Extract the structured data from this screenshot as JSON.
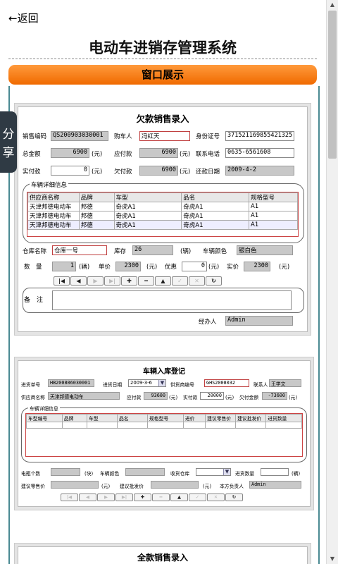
{
  "header": {
    "back_label": "返回",
    "title": "电动车进销存管理系统",
    "section_button": "窗口展示",
    "share_label": "分享"
  },
  "shot1": {
    "title": "欠款销售录入",
    "sales_code_label": "销售编码",
    "sales_code": "QS200903030001",
    "buyer_label": "购车人",
    "buyer": "冯红天",
    "id_label": "身份证号",
    "id_no": "371521169855421325",
    "total_label": "总金额",
    "total": "6900",
    "yuan1": "(元)",
    "due_label": "应付款",
    "due": "6900",
    "yuan2": "(元)",
    "phone_label": "联系电话",
    "phone": "0635-6561608",
    "paid_label": "实付款",
    "paid": "0",
    "yuan3": "(元)",
    "owed_label": "欠付款",
    "owed": "6900",
    "yuan4": "(元)",
    "repay_label": "还款日期",
    "repay_date": "2009-4-2",
    "detail_caption": "车辆详细信息",
    "columns": [
      "供应商名称",
      "品牌",
      "车型",
      "品名",
      "规格型号"
    ],
    "rows": [
      [
        "天津邦德电动车",
        "邦德",
        "奇虎A1",
        "奇虎A1",
        "A1"
      ],
      [
        "天津邦德电动车",
        "邦德",
        "奇虎A1",
        "奇虎A1",
        "A1"
      ],
      [
        "天津邦德电动车",
        "邦德",
        "奇虎A1",
        "奇虎A1",
        "A1"
      ]
    ],
    "warehouse_label": "仓库名称",
    "warehouse": "仓库一号",
    "stock_label": "库存",
    "stock": "26",
    "unit1": "(辆)",
    "color_label": "车辆颜色",
    "color": "银白色",
    "qty_label": "数　量",
    "qty": "1",
    "unit2": "(辆)",
    "price_label": "单价",
    "price": "2300",
    "yuan5": "(元)",
    "discount_label": "优惠",
    "discount": "0",
    "yuan6": "(元)",
    "actual_label": "实价",
    "actual": "2300",
    "yuan7": "(元)",
    "nav": [
      "|◀",
      "◀",
      "▶",
      "▶|",
      "✚",
      "━",
      "▲",
      "✓",
      "✕",
      "↻"
    ],
    "remark_label": "备　注",
    "handler_label": "经办人",
    "handler": "Admin"
  },
  "shot2": {
    "title": "车辆入库登记",
    "in_no_label": "进货单号",
    "in_no": "HB200806030001",
    "in_date_label": "进货日期",
    "in_date": "2009-3-6",
    "supplier_no_label": "供货商编号",
    "supplier_no": "GHS2008032",
    "contact_label": "联系人",
    "contact": "王学文",
    "supplier_name_label": "供应商名称",
    "supplier_name": "天津邦德电动车",
    "due_label": "应付款",
    "due": "93600",
    "yuan1": "(元)",
    "paid_label": "实付款",
    "paid": "20000",
    "yuan2": "(元)",
    "owed_label": "欠付金额",
    "owed": "-73600",
    "yuan3": "(元)",
    "detail_caption": "车辆详细信息",
    "columns": [
      "车型编号",
      "品牌",
      "车型",
      "品名",
      "规格型号",
      "进价",
      "建议零售价",
      "建议批发价",
      "进货数量"
    ],
    "battery_label": "电瓶个数",
    "unit1": "(块)",
    "color_label": "车辆颜色",
    "warehouse_label": "收货仓库",
    "qty_label": "进货数量",
    "unit2": "(辆)",
    "retail_label": "建议零售价",
    "yuan4": "(元)",
    "wholesale_label": "建议批发价",
    "yuan5": "(元)",
    "owner_label": "本方负责人",
    "owner": "Admin",
    "nav": [
      "|◀",
      "◀",
      "▶",
      "▶|",
      "✚",
      "━",
      "▲",
      "✓",
      "✕",
      "↻"
    ]
  },
  "shot3": {
    "title": "全款销售录入"
  }
}
